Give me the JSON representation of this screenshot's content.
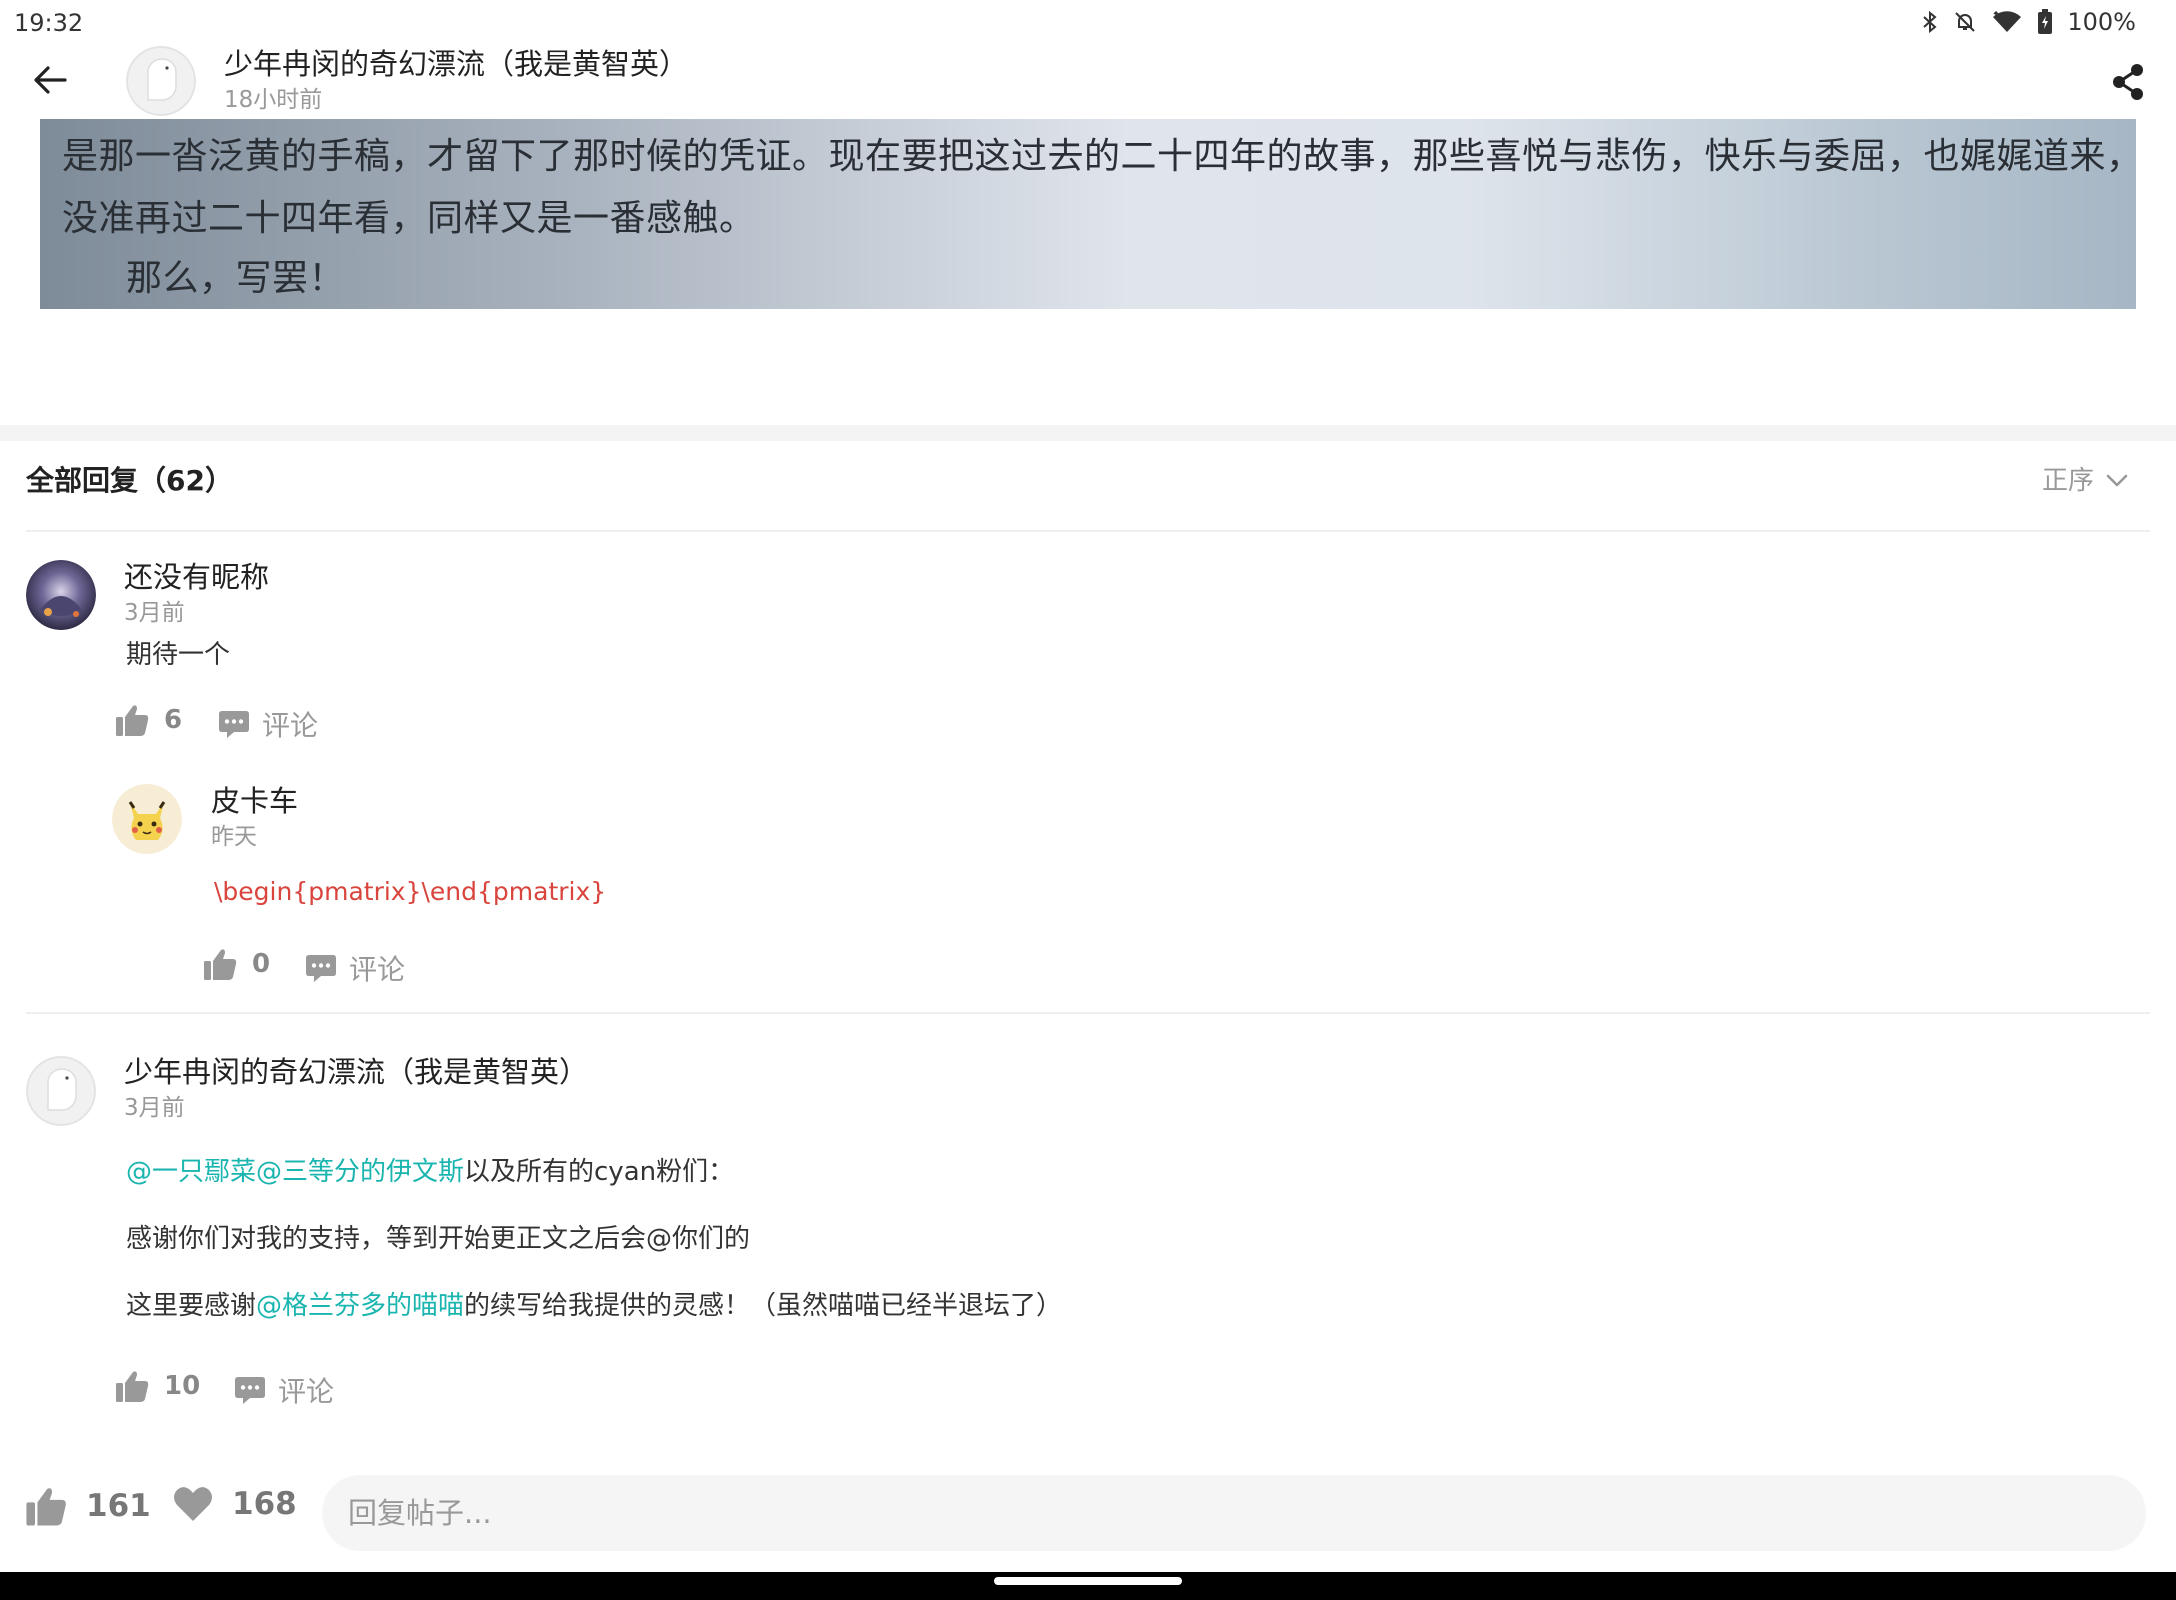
{
  "status_bar": {
    "time": "19:32",
    "battery": "100%",
    "icons": [
      "bluetooth-icon",
      "bell-off-icon",
      "wifi-icon",
      "battery-icon"
    ]
  },
  "header": {
    "title": "少年冉闵的奇幻漂流（我是黄智英）",
    "time": "18小时前",
    "icons": [
      "back-arrow-icon",
      "share-icon"
    ]
  },
  "post_image": {
    "line1": "是那一沓泛黄的手稿，才留下了那时候的凭证。现在要把这过去的二十四年的故事，那些喜悦与悲伤，快乐与委屈，也娓娓道来，",
    "line2": "没准再过二十四年看，同样又是一番感触。",
    "line3": "那么，写罢！"
  },
  "replies": {
    "title": "全部回复（62）",
    "sort_label": "正序",
    "items": [
      {
        "name": "还没有昵称",
        "time": "3月前",
        "text": "期待一个",
        "likes": "6",
        "comment_label": "评论",
        "sub_replies": [
          {
            "name": "皮卡车",
            "time": "昨天",
            "text": "\\begin{pmatrix}\\end{pmatrix}",
            "likes": "0",
            "comment_label": "评论"
          }
        ]
      },
      {
        "name": "少年冉闵的奇幻漂流（我是黄智英）",
        "time": "3月前",
        "p1_mention": "@一只鄢菜@三等分的伊文斯",
        "p1_rest": "以及所有的cyan粉们：",
        "p2": "感谢你们对我的支持，等到开始更正文之后会@你们的",
        "p3_start": "这里要感谢",
        "p3_mention": "@格兰芬多的喵喵",
        "p3_rest": "的续写给我提供的灵感！（虽然喵喵已经半退坛了）",
        "likes": "10",
        "comment_label": "评论"
      }
    ]
  },
  "bottom_bar": {
    "likes": "161",
    "favorites": "168",
    "input_placeholder": "回复帖子..."
  },
  "colors": {
    "mention": "#1bb5b0",
    "code_text": "#d9453d",
    "secondary_text": "#999999"
  }
}
